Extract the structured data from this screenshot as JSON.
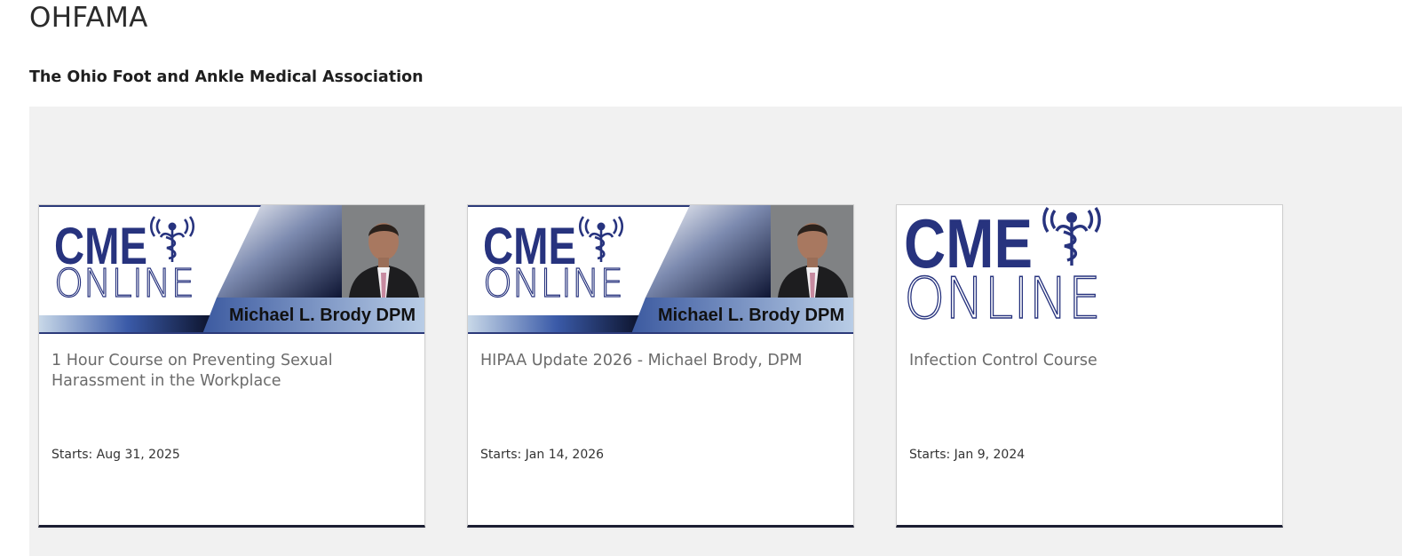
{
  "site": {
    "title": "OHFAMA",
    "subtitle": "The Ohio Foot and Ankle Medical Association"
  },
  "cards": [
    {
      "title": "1 Hour Course on Preventing Sexual Harassment in the Workplace",
      "starts": "Starts: Aug 31, 2025",
      "banner": {
        "logo_top": "CME",
        "logo_bottom": "ONLINE",
        "presenter": "Michael L. Brody DPM",
        "has_photo": true
      }
    },
    {
      "title": "HIPAA Update 2026 - Michael Brody, DPM",
      "starts": "Starts: Jan 14, 2026",
      "banner": {
        "logo_top": "CME",
        "logo_bottom": "ONLINE",
        "presenter": "Michael L. Brody DPM",
        "has_photo": true
      }
    },
    {
      "title": "Infection Control Course",
      "starts": "Starts: Jan 9, 2024",
      "banner": {
        "logo_top": "CME",
        "logo_bottom": "ONLINE",
        "has_photo": false
      }
    }
  ],
  "colors": {
    "logo_blue": "#27337e",
    "banner_navy": "#1a2a5c",
    "card_accent": "#1c1f33",
    "catalog_bg": "#f1f1f1"
  }
}
